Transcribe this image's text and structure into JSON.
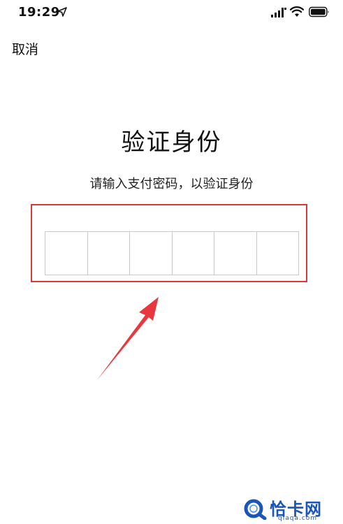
{
  "status_bar": {
    "time": "19:29",
    "icons": [
      "location-arrow-icon",
      "signal-icon",
      "wifi-icon",
      "battery-icon"
    ]
  },
  "nav": {
    "cancel_label": "取消"
  },
  "main": {
    "title": "验证身份",
    "subtitle": "请输入支付密码，以验证身份",
    "pin_length": 6,
    "pin_digits": [
      "",
      "",
      "",
      "",
      "",
      ""
    ]
  },
  "annotation": {
    "highlight_color": "#d9393a",
    "arrow_color": "#e8383d"
  },
  "watermark": {
    "name": "恰卡网",
    "url": "qiaqa.com",
    "color": "#1a56b8"
  }
}
